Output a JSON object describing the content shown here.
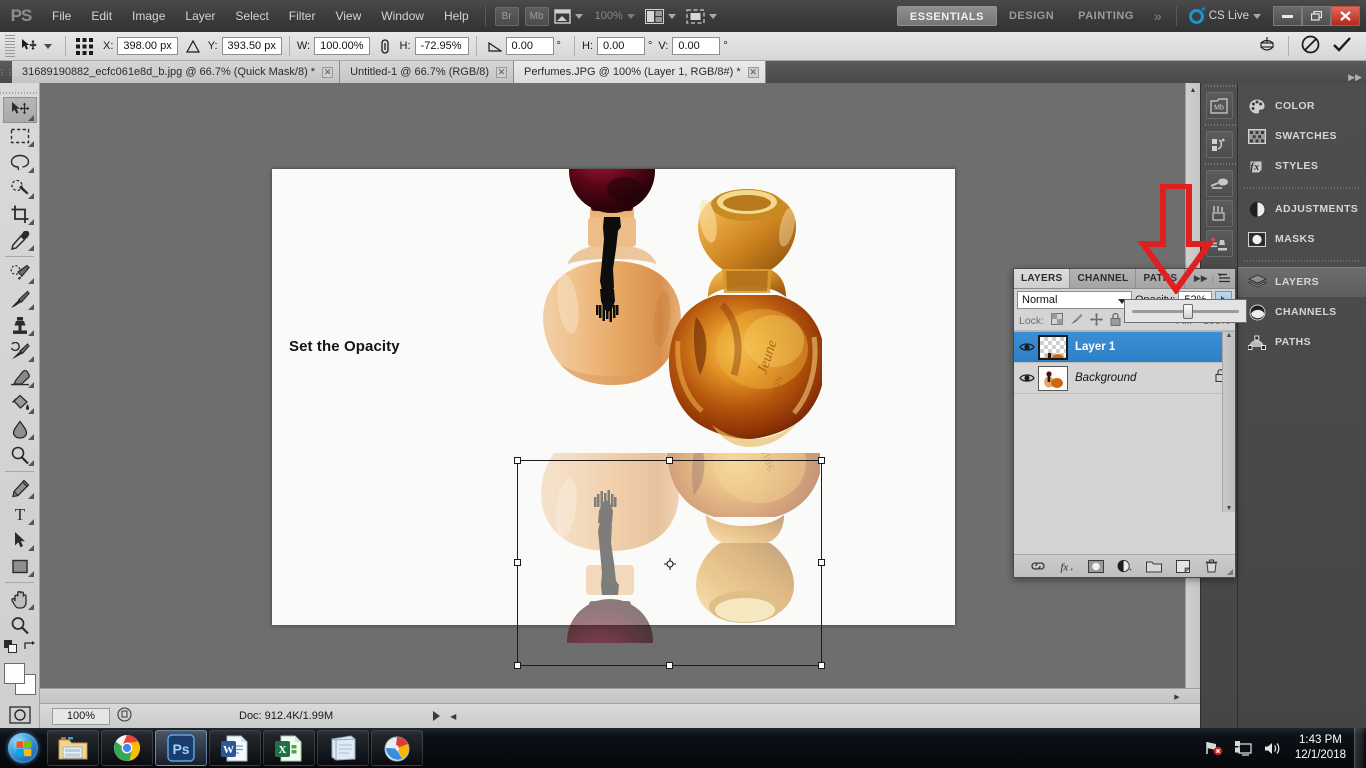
{
  "app": {
    "name": "Adobe Photoshop CS5",
    "logo": "PS"
  },
  "menubar": {
    "items": [
      "File",
      "Edit",
      "Image",
      "Layer",
      "Select",
      "Filter",
      "View",
      "Window",
      "Help"
    ],
    "bridge_label": "Br",
    "minibridge_label": "Mb",
    "zoom_label": "100%",
    "workspaces": [
      "ESSENTIALS",
      "DESIGN",
      "PAINTING"
    ],
    "workspace_active": "ESSENTIALS",
    "cslive_label": "CS Live",
    "window_controls": {
      "minimize": "–",
      "restore": "❐",
      "close": "✕"
    }
  },
  "options_bar": {
    "tool_name": "move-tool",
    "fields": [
      {
        "label": "X:",
        "value": "398.00 px"
      },
      {
        "label": "Y:",
        "value": "393.50 px"
      },
      {
        "label": "W:",
        "value": "100.00%"
      },
      {
        "label": "H:",
        "value": "-72.95%"
      }
    ],
    "angle": {
      "label": "",
      "value": "0.00",
      "unit": "°"
    },
    "skew_h": {
      "label": "H:",
      "value": "0.00",
      "unit": "°"
    },
    "skew_v": {
      "label": "V:",
      "value": "0.00",
      "unit": "°"
    },
    "cancel_title": "Cancel transform",
    "commit_title": "Commit transform",
    "warp_title": "Switch between free transform and warp modes"
  },
  "tabs": [
    {
      "title": "31689190882_ecfc061e8d_b.jpg @ 66.7% (Quick Mask/8) *",
      "active": false,
      "close": "✕"
    },
    {
      "title": "Untitled-1 @ 66.7% (RGB/8)",
      "active": false,
      "close": "✕"
    },
    {
      "title": "Perfumes.JPG @ 100% (Layer 1, RGB/8#) *",
      "active": true,
      "close": "✕"
    }
  ],
  "toolbox": {
    "tools": [
      "move-tool",
      "rectangular-marquee-tool",
      "lasso-tool",
      "quick-selection-tool",
      "crop-tool",
      "eyedropper-tool",
      "spot-healing-brush-tool",
      "brush-tool",
      "clone-stamp-tool",
      "history-brush-tool",
      "eraser-tool",
      "gradient-tool",
      "blur-tool",
      "dodge-tool",
      "pen-tool",
      "horizontal-type-tool",
      "path-selection-tool",
      "rectangle-tool",
      "hand-tool",
      "zoom-tool"
    ],
    "selected": "move-tool",
    "foreground_color": "#fdfdfd",
    "background_color": "#ffffff",
    "quickmask_label": "edit-in-quick-mask-mode"
  },
  "canvas": {
    "document_caption": "Set the Opacity",
    "background_color": "#6e6e6e",
    "paper_color": "#fafaf8",
    "reflection_opacity": 0.52,
    "selection": {
      "handles": 8,
      "reference_point": "center"
    }
  },
  "status_bar": {
    "zoom": "100%",
    "doc_info": "Doc: 912.4K/1.99M"
  },
  "icon_rail": {
    "items": [
      "mini-bridge-icon",
      "history-icon",
      "brush-presets-icon",
      "tool-presets-icon",
      "clone-source-icon"
    ]
  },
  "dock": {
    "groups": [
      [
        {
          "label": "COLOR",
          "icon": "color-palette-icon",
          "active": false
        },
        {
          "label": "SWATCHES",
          "icon": "swatches-grid-icon",
          "active": false
        },
        {
          "label": "STYLES",
          "icon": "styles-fx-icon",
          "active": false
        }
      ],
      [
        {
          "label": "ADJUSTMENTS",
          "icon": "adjustments-circle-icon",
          "active": false
        },
        {
          "label": "MASKS",
          "icon": "masks-icon",
          "active": false
        }
      ],
      [
        {
          "label": "LAYERS",
          "icon": "layers-stack-icon",
          "active": true
        },
        {
          "label": "CHANNELS",
          "icon": "channels-sphere-icon",
          "active": false
        },
        {
          "label": "PATHS",
          "icon": "paths-pen-icon",
          "active": false
        }
      ]
    ]
  },
  "layers_panel": {
    "tabs": [
      {
        "label": "LAYERS",
        "active": true
      },
      {
        "label": "CHANNEL",
        "active": false
      },
      {
        "label": "PATHS",
        "active": false
      }
    ],
    "collapse_icon": "collapse-panel-icon",
    "menu_icon": "panel-menu-icon",
    "blend_mode": "Normal",
    "opacity_label": "Opacity:",
    "opacity_value": "52%",
    "opacity_slider_percent": 52,
    "lock_label": "Lock:",
    "lock_icons": [
      "lock-transparent-pixels-icon",
      "lock-image-pixels-icon",
      "lock-position-icon",
      "lock-all-icon"
    ],
    "fill_label": "Fill:",
    "fill_value": "100%",
    "layers": [
      {
        "name": "Layer 1",
        "visible": true,
        "selected": true,
        "locked": false,
        "transparent_thumb": true
      },
      {
        "name": "Background",
        "visible": true,
        "selected": false,
        "locked": true,
        "transparent_thumb": false
      }
    ],
    "bottom_buttons": [
      "link-layers-icon",
      "add-layer-style-icon",
      "add-layer-mask-icon",
      "new-adjustment-layer-icon",
      "new-group-icon",
      "new-layer-icon",
      "delete-layer-icon"
    ]
  },
  "annotation": {
    "arrow": "red-down-arrow",
    "color": "#e02020"
  },
  "taskbar": {
    "start_label": "start-orb",
    "buttons": [
      {
        "name": "windows-explorer",
        "active": false
      },
      {
        "name": "google-chrome",
        "active": false
      },
      {
        "name": "adobe-photoshop",
        "active": true
      },
      {
        "name": "microsoft-word",
        "active": false
      },
      {
        "name": "microsoft-excel",
        "active": false
      },
      {
        "name": "notepad",
        "active": false
      },
      {
        "name": "paint",
        "active": false
      }
    ],
    "tray": [
      "network-error-icon",
      "action-center-icon",
      "volume-icon"
    ],
    "time": "1:43 PM",
    "date": "12/1/2018"
  }
}
